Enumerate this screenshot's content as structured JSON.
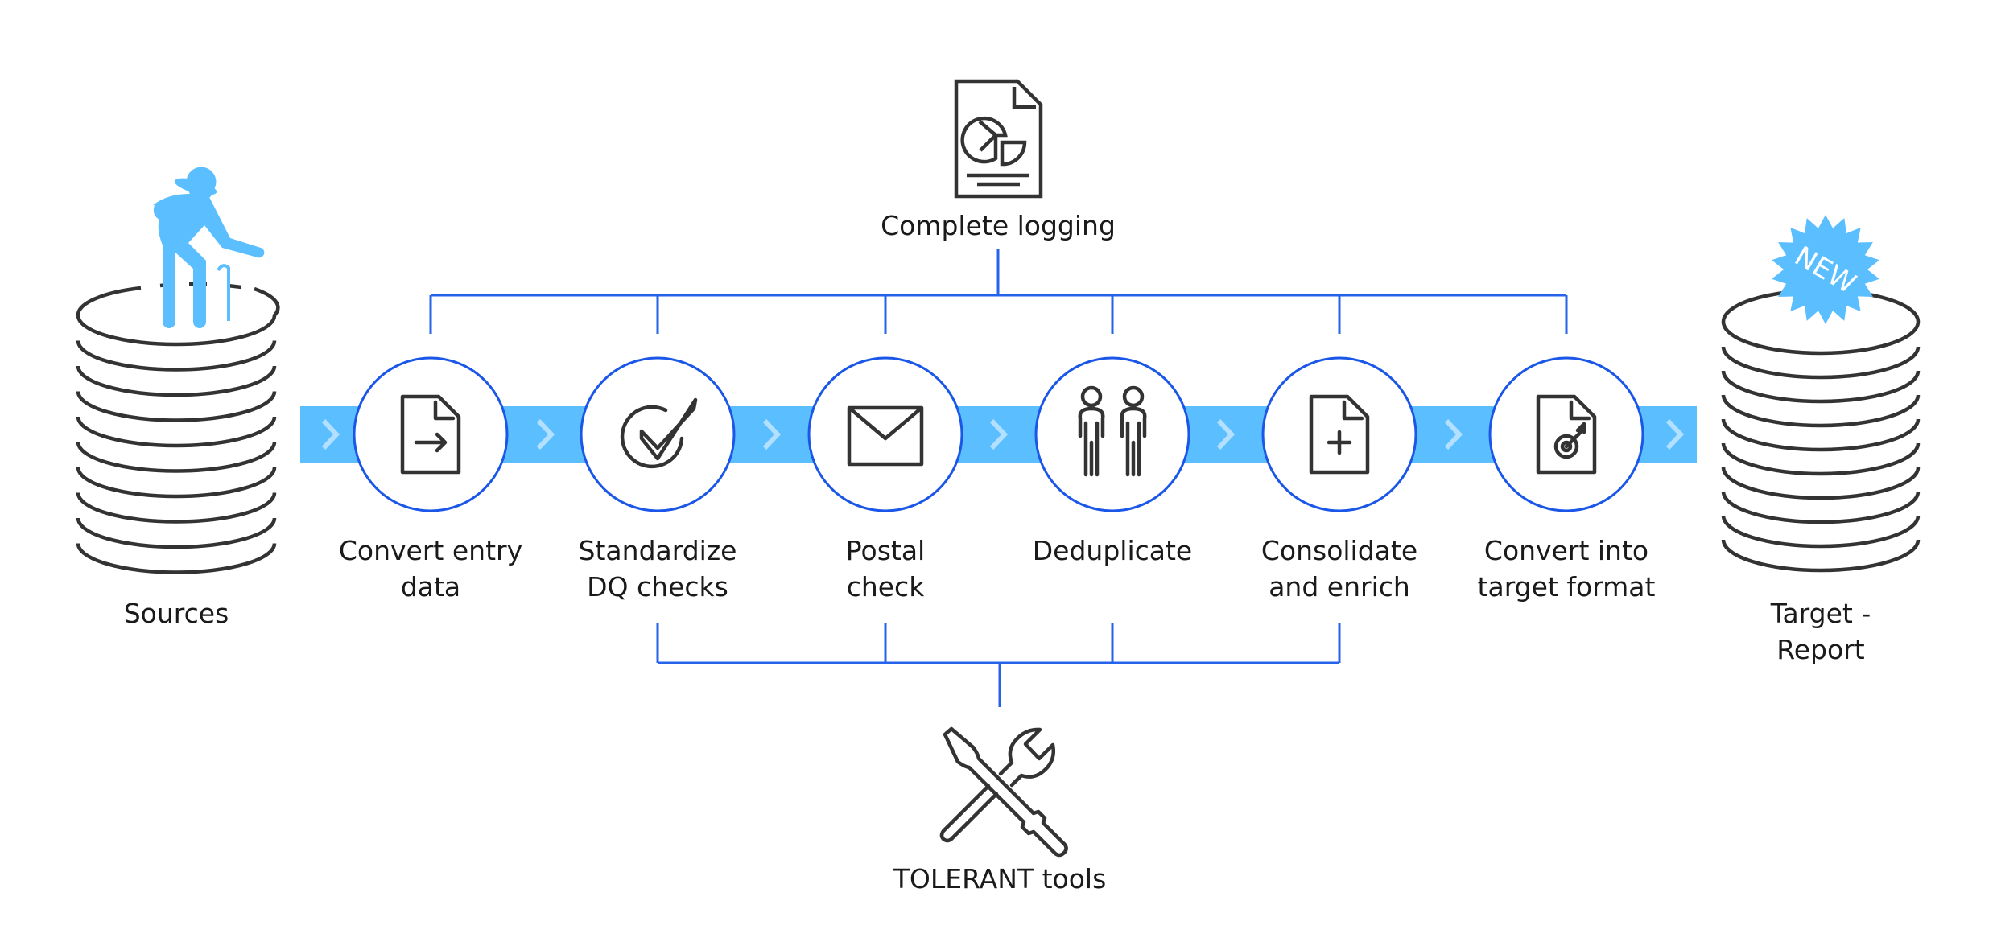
{
  "colors": {
    "band": "#5bbfff",
    "chevron": "#b3e0ff",
    "circle_stroke": "#1a56e8",
    "bracket": "#2563eb",
    "icon_stroke": "#333333",
    "accent": "#5bbfff"
  },
  "source": {
    "label": "Sources",
    "icon": "elderly-person-icon"
  },
  "target": {
    "label": "Target -\nReport",
    "badge": "NEW"
  },
  "logging": {
    "label": "Complete logging",
    "icon": "report-pie-chart-icon"
  },
  "tools": {
    "label": "TOLERANT tools",
    "icon": "screwdriver-wrench-icon"
  },
  "steps": [
    {
      "label": "Convert entry\ndata",
      "icon": "document-arrow-icon"
    },
    {
      "label": "Standardize\nDQ checks",
      "icon": "check-circle-icon"
    },
    {
      "label": "Postal\ncheck",
      "icon": "envelope-icon"
    },
    {
      "label": "Deduplicate",
      "icon": "two-people-icon"
    },
    {
      "label": "Consolidate\nand enrich",
      "icon": "document-plus-icon"
    },
    {
      "label": "Convert into\ntarget format",
      "icon": "document-target-icon"
    }
  ]
}
